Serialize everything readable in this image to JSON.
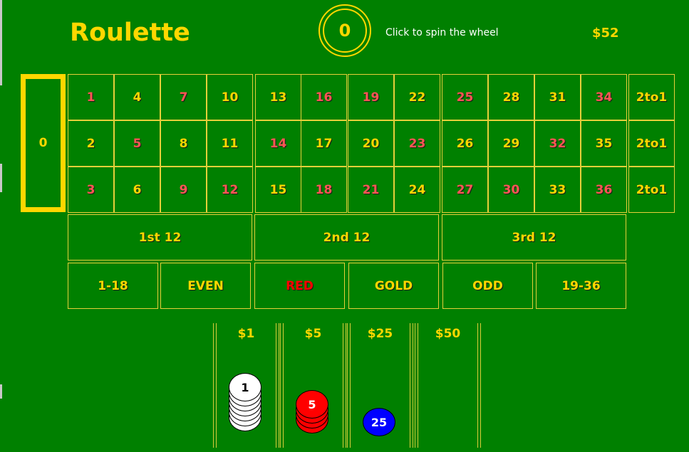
{
  "header": {
    "title": "Roulette",
    "wheel_number": "0",
    "hint": "Click to spin the wheel",
    "balance": "$52"
  },
  "zero_label": "0",
  "grid": {
    "rows": [
      [
        {
          "label": "1",
          "color": "red"
        },
        {
          "label": "4",
          "color": "black"
        },
        {
          "label": "7",
          "color": "red"
        },
        {
          "label": "10",
          "color": "black"
        },
        {
          "label": "13",
          "color": "black"
        },
        {
          "label": "16",
          "color": "red"
        },
        {
          "label": "19",
          "color": "red"
        },
        {
          "label": "22",
          "color": "black"
        },
        {
          "label": "25",
          "color": "red"
        },
        {
          "label": "28",
          "color": "black"
        },
        {
          "label": "31",
          "color": "black"
        },
        {
          "label": "34",
          "color": "red"
        }
      ],
      [
        {
          "label": "2",
          "color": "black"
        },
        {
          "label": "5",
          "color": "red"
        },
        {
          "label": "8",
          "color": "black"
        },
        {
          "label": "11",
          "color": "black"
        },
        {
          "label": "14",
          "color": "red"
        },
        {
          "label": "17",
          "color": "black"
        },
        {
          "label": "20",
          "color": "black"
        },
        {
          "label": "23",
          "color": "red"
        },
        {
          "label": "26",
          "color": "black"
        },
        {
          "label": "29",
          "color": "black"
        },
        {
          "label": "32",
          "color": "red"
        },
        {
          "label": "35",
          "color": "black"
        }
      ],
      [
        {
          "label": "3",
          "color": "red"
        },
        {
          "label": "6",
          "color": "black"
        },
        {
          "label": "9",
          "color": "red"
        },
        {
          "label": "12",
          "color": "red"
        },
        {
          "label": "15",
          "color": "black"
        },
        {
          "label": "18",
          "color": "red"
        },
        {
          "label": "21",
          "color": "red"
        },
        {
          "label": "24",
          "color": "black"
        },
        {
          "label": "27",
          "color": "red"
        },
        {
          "label": "30",
          "color": "red"
        },
        {
          "label": "33",
          "color": "black"
        },
        {
          "label": "36",
          "color": "red"
        }
      ]
    ],
    "column_bets": [
      "2to1",
      "2to1",
      "2to1"
    ]
  },
  "dozens": [
    "1st 12",
    "2nd 12",
    "3rd 12"
  ],
  "outside_bets": [
    {
      "label": "1-18",
      "color": "yellow"
    },
    {
      "label": "EVEN",
      "color": "yellow"
    },
    {
      "label": "RED",
      "color": "red"
    },
    {
      "label": "GOLD",
      "color": "yellow"
    },
    {
      "label": "ODD",
      "color": "yellow"
    },
    {
      "label": "19-36",
      "color": "yellow"
    }
  ],
  "chip_columns": [
    {
      "label": "$1",
      "chip_value": "1",
      "count": 7,
      "chip_color": "#ffffff",
      "text_color": "#000000"
    },
    {
      "label": "$5",
      "chip_value": "5",
      "count": 4,
      "chip_color": "#ff0000",
      "text_color": "#ffffff"
    },
    {
      "label": "$25",
      "chip_value": "25",
      "count": 1,
      "chip_color": "#0000ff",
      "text_color": "#ffffff"
    },
    {
      "label": "$50",
      "chip_value": "",
      "count": 0,
      "chip_color": "",
      "text_color": ""
    }
  ],
  "colors": {
    "felt": "#008000",
    "gold": "#ffd700",
    "red_number": "#ff5555"
  }
}
